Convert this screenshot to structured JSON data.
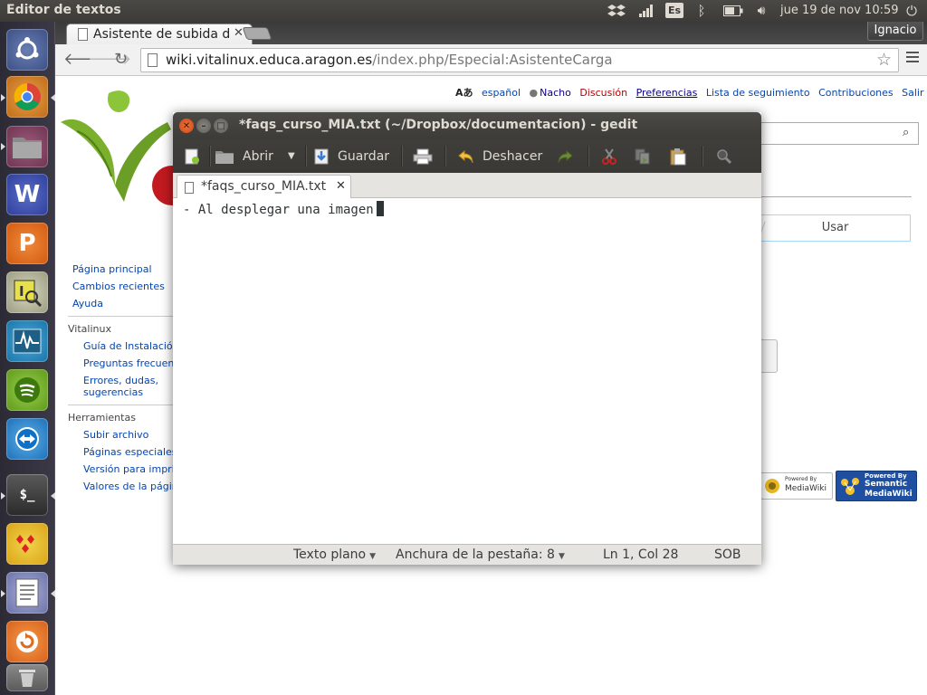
{
  "top_panel": {
    "app_title": "Editor de textos",
    "keyboard_layout": "Es",
    "clock": "jue 19 de nov 10:59",
    "indicators": [
      "dropbox-icon",
      "network-icon",
      "keyboard-icon",
      "bluetooth-icon",
      "battery-icon",
      "volume-icon",
      "power-icon"
    ]
  },
  "launcher": {
    "items": [
      "ubuntu-dash",
      "chrome",
      "files",
      "writer",
      "presentation",
      "input-method",
      "system-monitor",
      "spotify",
      "teamviewer",
      "terminal",
      "game",
      "text-editor",
      "software-updater",
      "trash"
    ]
  },
  "browser": {
    "tab_title": "Asistente de subida de archivos",
    "profile_name": "Ignacio",
    "url_host": "wiki.vitalinux.educa.aragon.es",
    "url_path": "/index.php/Especial:AsistenteCarga"
  },
  "wiki": {
    "personal": {
      "language": "español",
      "user": "Nacho",
      "discussion": "Discusión",
      "preferences": "Preferencias",
      "watchlist": "Lista de seguimiento",
      "contributions": "Contribuciones",
      "logout": "Salir"
    },
    "nav": [
      "Página principal",
      "Cambios recientes",
      "Ayuda"
    ],
    "vitalinux_heading": "Vitalinux",
    "vitalinux_links": [
      "Guía de Instalación",
      "Preguntas frecuentes",
      "Errores, dudas,",
      "sugerencias"
    ],
    "tools_heading": "Herramientas",
    "tools_links": [
      "Subir archivo",
      "Páginas especiales",
      "Versión para imprimir",
      "Valores de la página"
    ],
    "use_button": "Usar",
    "badge_mediawiki_top": "Powered By",
    "badge_mediawiki": "MediaWiki",
    "badge_smw_top": "Powered By",
    "badge_smw_1": "Semantic",
    "badge_smw_2": "MediaWiki"
  },
  "gedit": {
    "window_title": "*faqs_curso_MIA.txt (~/Dropbox/documentacion) - gedit",
    "toolbar": {
      "open": "Abrir",
      "save": "Guardar",
      "undo": "Deshacer"
    },
    "tab_label": "*faqs_curso_MIA.txt",
    "content": "- Al desplegar una imagen",
    "status": {
      "language": "Texto plano",
      "tab_width": "Anchura de la pestaña: 8",
      "position": "Ln 1, Col 28",
      "mode": "SOB"
    }
  },
  "colors": {
    "panel": "#3c3b37",
    "launcher": "#2c2a35",
    "close_orange": "#e95420",
    "link": "#0645ad",
    "redlink": "#ba0000"
  }
}
